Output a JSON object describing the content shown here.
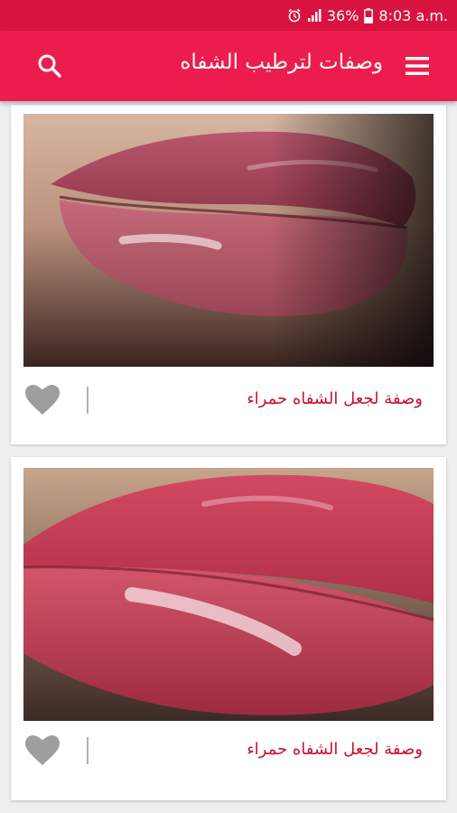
{
  "status_bar": {
    "battery_percent": "36%",
    "time": "8:03 a.m.",
    "icons": [
      "alarm-icon",
      "signal-icon",
      "battery-icon"
    ]
  },
  "app_bar": {
    "title": "وصفات لترطيب الشفاه",
    "icons": [
      "menu-icon",
      "search-icon"
    ]
  },
  "colors": {
    "status_bar": "#d8143e",
    "app_bar": "#ec1d4c",
    "accent_text": "#c8102e",
    "favorite_icon": "#9e9e9e"
  },
  "cards": [
    {
      "title": "وصفة لجعل الشفاه حمراء",
      "image": "lips-photo",
      "favorite_icon": "heart-icon"
    },
    {
      "title": "وصفة لجعل الشفاه حمراء",
      "image": "glossy-lips-photo",
      "favorite_icon": "heart-icon"
    }
  ]
}
